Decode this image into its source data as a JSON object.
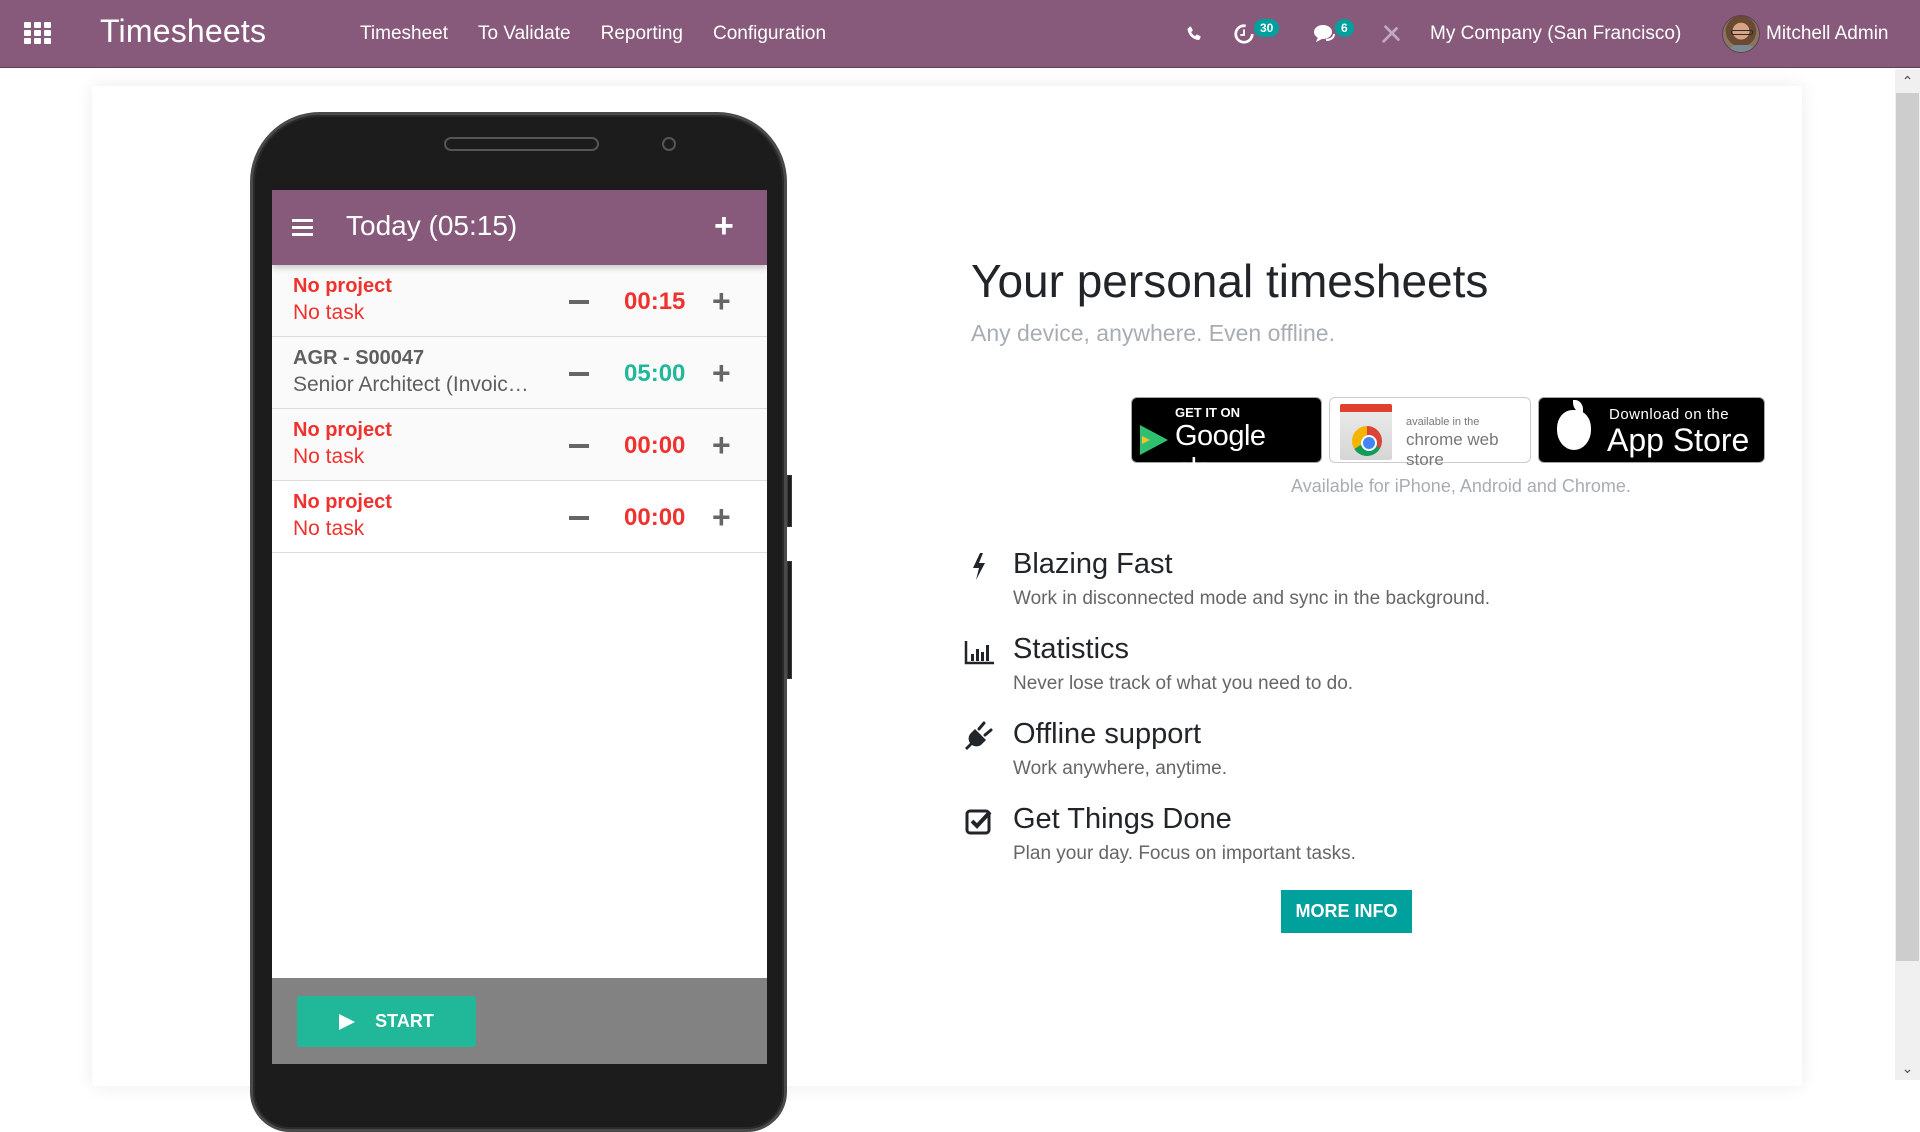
{
  "navbar": {
    "app_title": "Timesheets",
    "menu": [
      {
        "label": "Timesheet"
      },
      {
        "label": "To Validate"
      },
      {
        "label": "Reporting"
      },
      {
        "label": "Configuration"
      }
    ],
    "systray": {
      "phone_icon": "phone-icon",
      "activity_icon": "clock-icon",
      "activity_count": "30",
      "messages_icon": "chat-icon",
      "messages_count": "6",
      "debug_icon": "tools-icon",
      "company": "My Company (San Francisco)",
      "user_name": "Mitchell Admin"
    },
    "colors": {
      "brand": "#875A7B",
      "badge": "#00A09D"
    }
  },
  "phone_mockup": {
    "header_title": "Today (05:15)",
    "rows": [
      {
        "project": "No project",
        "task": "No task",
        "time": "00:15",
        "status": "error"
      },
      {
        "project": "AGR - S00047",
        "task": "Senior Architect (Invoic…",
        "time": "05:00",
        "status": "ok"
      },
      {
        "project": "No project",
        "task": "No task",
        "time": "00:00",
        "status": "error"
      },
      {
        "project": "No project",
        "task": "No task",
        "time": "00:00",
        "status": "error"
      }
    ],
    "start_label": "START",
    "colors": {
      "error": "#F0322E",
      "ok": "#21B799"
    }
  },
  "promo": {
    "headline": "Your personal timesheets",
    "subheadline": "Any device, anywhere. Even offline.",
    "stores": {
      "google_play_small": "GET IT ON",
      "google_play_big": "Google play",
      "chrome_small": "available in the",
      "chrome_big": "chrome web store",
      "app_store_small": "Download on the",
      "app_store_big": "App Store"
    },
    "availability": "Available for iPhone, Android and Chrome.",
    "features": [
      {
        "icon": "bolt-icon",
        "title": "Blazing Fast",
        "description": "Work in disconnected mode and sync in the background."
      },
      {
        "icon": "bar-chart-icon",
        "title": "Statistics",
        "description": "Never lose track of what you need to do."
      },
      {
        "icon": "plug-icon",
        "title": "Offline support",
        "description": "Work anywhere, anytime."
      },
      {
        "icon": "check-square-icon",
        "title": "Get Things Done",
        "description": "Plan your day. Focus on important tasks."
      }
    ],
    "more_info_label": "MORE INFO"
  }
}
